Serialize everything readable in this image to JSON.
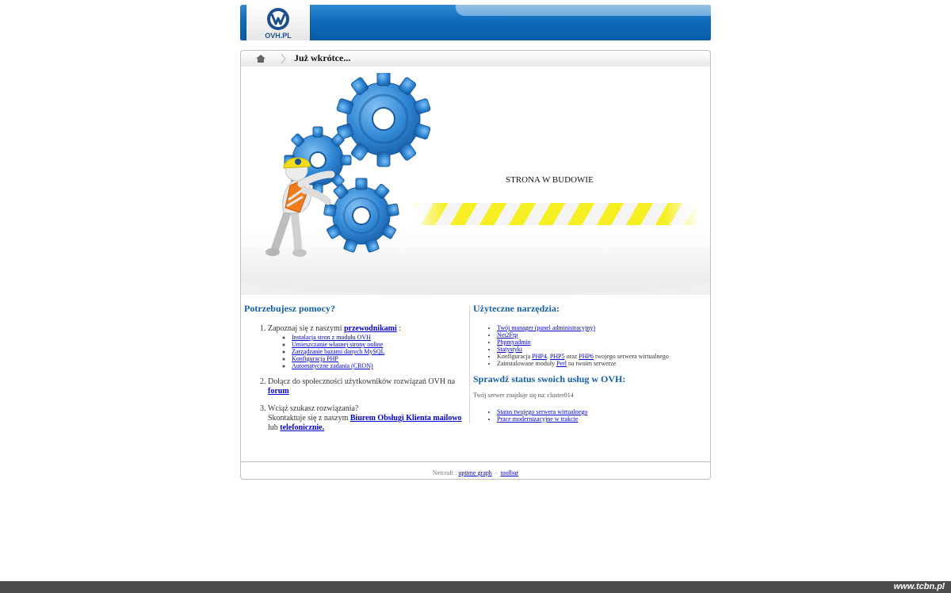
{
  "header": {
    "logo_text": "OVH.PL"
  },
  "breadcrumb": {
    "title": "Już wkrótce..."
  },
  "hero": {
    "status_text": "STRONA W BUDOWIE"
  },
  "help": {
    "heading": "Potrzebujesz pomocy?",
    "item1_prefix": "Zapoznaj się z naszymi",
    "item1_link": "przewodnikami",
    "item1_suffix": ":",
    "guides": [
      "Instalacja stron z modułu OVH",
      "Umieszczanie własnej strony online",
      "Zarządzanie bazami danych MySQL",
      "Konfiguracja PHP",
      "Automatyczne zadania (CRON)"
    ],
    "item2_text": "Dołącz do społeczności użytkowników rozwiązań OVH na",
    "item2_link": "forum",
    "item3_line1": "Wciąż szukasz rozwiązania?",
    "item3_prefix": "Skontaktuje się z naszym",
    "item3_link": "Biurem Obsługi Klienta mailowo",
    "item3_or": "lub",
    "item3_link2": "telefonicznie."
  },
  "tools": {
    "heading": "Użyteczne narzędzia:",
    "manager": "Twój manager (panel administracyjny)",
    "net2ftp": "Net2Ftp",
    "phpmyadmin": "Phpmyadmin",
    "stats": "Statystyki",
    "config_prefix": "Konfiguracja",
    "php4": "PHP4",
    "php5": "PHP5",
    "and": "oraz",
    "php6": "PHP6",
    "config_suffix": "twojego serwera wirtualnego",
    "modules_prefix": "Zainstalowane moduły",
    "perl": "Perl",
    "modules_suffix": "na twoim serwerze"
  },
  "status": {
    "heading": "Sprawdź status swoich usług w OVH:",
    "server_note": "Twój serwer znajduje się na: cluster014",
    "link_status": "Status twojego serwera wirtualnego",
    "link_works": "Prace modernizacyjne w trakcie"
  },
  "footer": {
    "prefix": "Netcraft :",
    "uptime": "uptime graph",
    "dash": "-",
    "toolbar": "toolbar"
  },
  "watermark": "www.tcbn.pl",
  "colors": {
    "brand_blue": "#0f6cbb",
    "heading_blue": "#1460a8",
    "stripe_yellow": "#f5ef24"
  }
}
